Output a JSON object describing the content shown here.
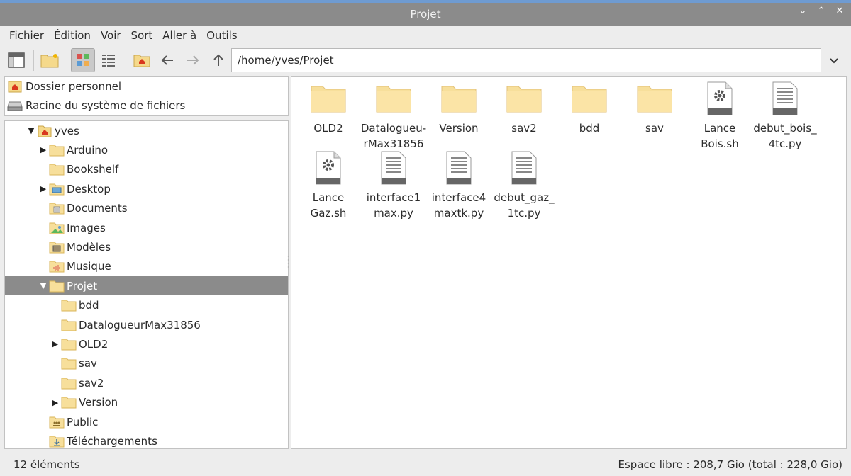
{
  "window": {
    "title": "Projet",
    "controls": [
      "⌄",
      "⌃",
      "✕"
    ]
  },
  "menu": [
    "Fichier",
    "Édition",
    "Voir",
    "Sort",
    "Aller à",
    "Outils"
  ],
  "path": {
    "value": "/home/yves/Projet"
  },
  "places": [
    {
      "label": "Dossier personnel",
      "icon": "home-icon"
    },
    {
      "label": "Racine du système de fichiers",
      "icon": "drive-icon"
    }
  ],
  "tree": [
    {
      "label": "yves",
      "level": 0,
      "arrow": "▼",
      "icon": "home-icon"
    },
    {
      "label": "Arduino",
      "level": 1,
      "arrow": "▶",
      "icon": "folder-icon"
    },
    {
      "label": "Bookshelf",
      "level": 1,
      "arrow": "",
      "icon": "folder-icon"
    },
    {
      "label": "Desktop",
      "level": 1,
      "arrow": "▶",
      "icon": "desktop-icon"
    },
    {
      "label": "Documents",
      "level": 1,
      "arrow": "",
      "icon": "documents-icon"
    },
    {
      "label": "Images",
      "level": 1,
      "arrow": "",
      "icon": "images-icon"
    },
    {
      "label": "Modèles",
      "level": 1,
      "arrow": "",
      "icon": "templates-icon"
    },
    {
      "label": "Musique",
      "level": 1,
      "arrow": "",
      "icon": "music-icon"
    },
    {
      "label": "Projet",
      "level": 1,
      "arrow": "▼",
      "icon": "folder-icon",
      "selected": true
    },
    {
      "label": "bdd",
      "level": 2,
      "arrow": "",
      "icon": "folder-icon"
    },
    {
      "label": "DatalogueurMax31856",
      "level": 2,
      "arrow": "",
      "icon": "folder-icon"
    },
    {
      "label": "OLD2",
      "level": 2,
      "arrow": "▶",
      "icon": "folder-icon"
    },
    {
      "label": "sav",
      "level": 2,
      "arrow": "",
      "icon": "folder-icon"
    },
    {
      "label": "sav2",
      "level": 2,
      "arrow": "",
      "icon": "folder-icon"
    },
    {
      "label": "Version",
      "level": 2,
      "arrow": "▶",
      "icon": "folder-icon"
    },
    {
      "label": "Public",
      "level": 1,
      "arrow": "",
      "icon": "public-icon"
    },
    {
      "label": "Téléchargements",
      "level": 1,
      "arrow": "",
      "icon": "downloads-icon"
    }
  ],
  "files": [
    {
      "name": "OLD2",
      "type": "folder"
    },
    {
      "name": "Datalogueu-\nrMax31856",
      "type": "folder"
    },
    {
      "name": "Version",
      "type": "folder"
    },
    {
      "name": "sav2",
      "type": "folder"
    },
    {
      "name": "bdd",
      "type": "folder"
    },
    {
      "name": "sav",
      "type": "folder"
    },
    {
      "name": "Lance\nBois.sh",
      "type": "script"
    },
    {
      "name": "debut_bois_\n4tc.py",
      "type": "text"
    },
    {
      "name": "Lance\nGaz.sh",
      "type": "script"
    },
    {
      "name": "interface1\nmax.py",
      "type": "text"
    },
    {
      "name": "interface4\nmaxtk.py",
      "type": "text"
    },
    {
      "name": "debut_gaz_\n1tc.py",
      "type": "text"
    }
  ],
  "status": {
    "count": "12 éléments",
    "free_space": "Espace libre : 208,7 Gio (total : 228,0 Gio)"
  },
  "colors": {
    "folder": "#f5d98b",
    "folder_dark": "#e9c46a",
    "selection": "#8b8b8b",
    "titlebar": "#8b8b8b",
    "accent": "#6f9bd1"
  }
}
